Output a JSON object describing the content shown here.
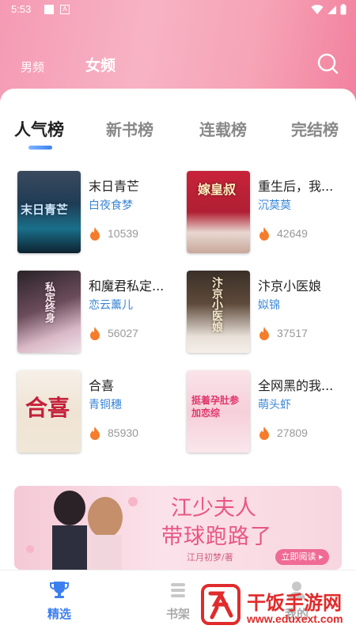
{
  "status_bar": {
    "time": "5:53"
  },
  "categories": {
    "male": "男频",
    "female": "女频"
  },
  "rank_tabs": [
    "人气榜",
    "新书榜",
    "连载榜",
    "完结榜"
  ],
  "books": [
    {
      "title": "末日青芒",
      "author": "白夜食梦",
      "heat": "10539",
      "cover_text": "末日青芒"
    },
    {
      "title": "重生后，我...",
      "author": "沉莫莫",
      "heat": "42649",
      "cover_text": "嫁皇叔"
    },
    {
      "title": "和魔君私定...",
      "author": "恋云薰儿",
      "heat": "56027",
      "cover_text": "私定终身"
    },
    {
      "title": "汴京小医娘",
      "author": "姒锦",
      "heat": "37517",
      "cover_text": "汴京小医娘"
    },
    {
      "title": "合喜",
      "author": "青铜穗",
      "heat": "85930",
      "cover_text": "合喜"
    },
    {
      "title": "全网黑的我...",
      "author": "萌头虾",
      "heat": "27809",
      "cover_text": "挺着孕肚参加恋综"
    }
  ],
  "banner": {
    "title_line1": "江少夫人",
    "title_line2": "带球跑路了",
    "author": "江月初梦/著",
    "button": "立即阅读 ▸"
  },
  "bottom_nav": [
    {
      "label": "精选",
      "icon": "trophy-icon",
      "active": true
    },
    {
      "label": "书架",
      "icon": "bookshelf-icon",
      "active": false
    },
    {
      "label": "我的",
      "icon": "profile-icon",
      "active": false
    }
  ],
  "watermark": {
    "text": "干饭手游网",
    "url": "www.eduxext.com"
  },
  "colors": {
    "accent": "#3d7ff0",
    "header_pink": "#f59ab4",
    "author_blue": "#3a86d6",
    "heat_orange": "#f57c2b"
  }
}
